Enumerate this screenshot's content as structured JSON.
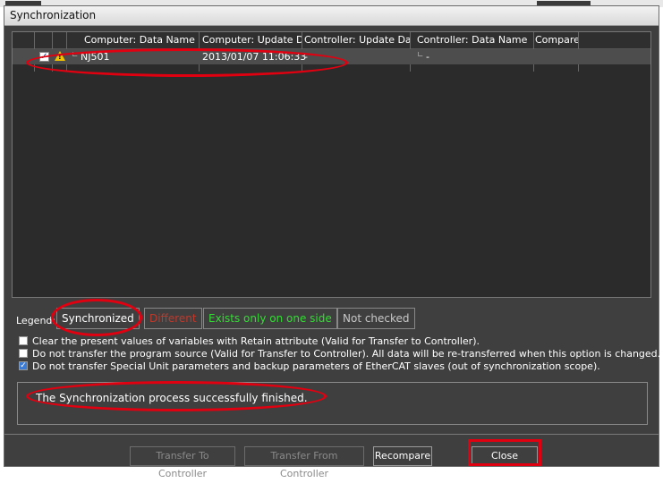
{
  "window": {
    "title": "Synchronization"
  },
  "table": {
    "headers": {
      "computer_name": "Computer: Data Name",
      "computer_update": "Computer: Update Da",
      "controller_update": "Controller: Update Da",
      "controller_name": "Controller: Data Name",
      "compare": "Compare"
    },
    "rows": [
      {
        "checked": true,
        "warning": true,
        "computer_name": "NJ501",
        "computer_update": "2013/01/07 11:06:33",
        "controller_update": "-",
        "controller_name": "-",
        "compare": ""
      }
    ]
  },
  "legend": {
    "label": "Legend:",
    "synchronized": "Synchronized",
    "different": "Different",
    "one_side": "Exists only on one side",
    "not_checked": "Not checked",
    "colors": {
      "synchronized": "#ffffff",
      "different": "#c0392b",
      "one_side": "#33dd33",
      "not_checked": "#c8c8c8"
    }
  },
  "options": [
    {
      "checked": false,
      "label": "Clear the present values of variables with Retain attribute (Valid for Transfer to Controller)."
    },
    {
      "checked": false,
      "label": "Do not transfer the program source (Valid for Transfer to Controller). All data will be re-transferred when this option is changed."
    },
    {
      "checked": true,
      "label": "Do not transfer Special Unit parameters and backup parameters of EtherCAT slaves (out of synchronization scope)."
    }
  ],
  "status": {
    "message": "The Synchronization process successfully finished."
  },
  "buttons": {
    "transfer_to": "Transfer To Controller",
    "transfer_from": "Transfer From Controller",
    "recompare": "Recompare",
    "close": "Close"
  },
  "icons": {
    "checkbox": "checkbox-icon",
    "warning": "warning-icon",
    "expand": "tree-expander-icon"
  },
  "accent": {
    "annotation_red": "#e00010",
    "window_bg": "#3f3f3f"
  }
}
